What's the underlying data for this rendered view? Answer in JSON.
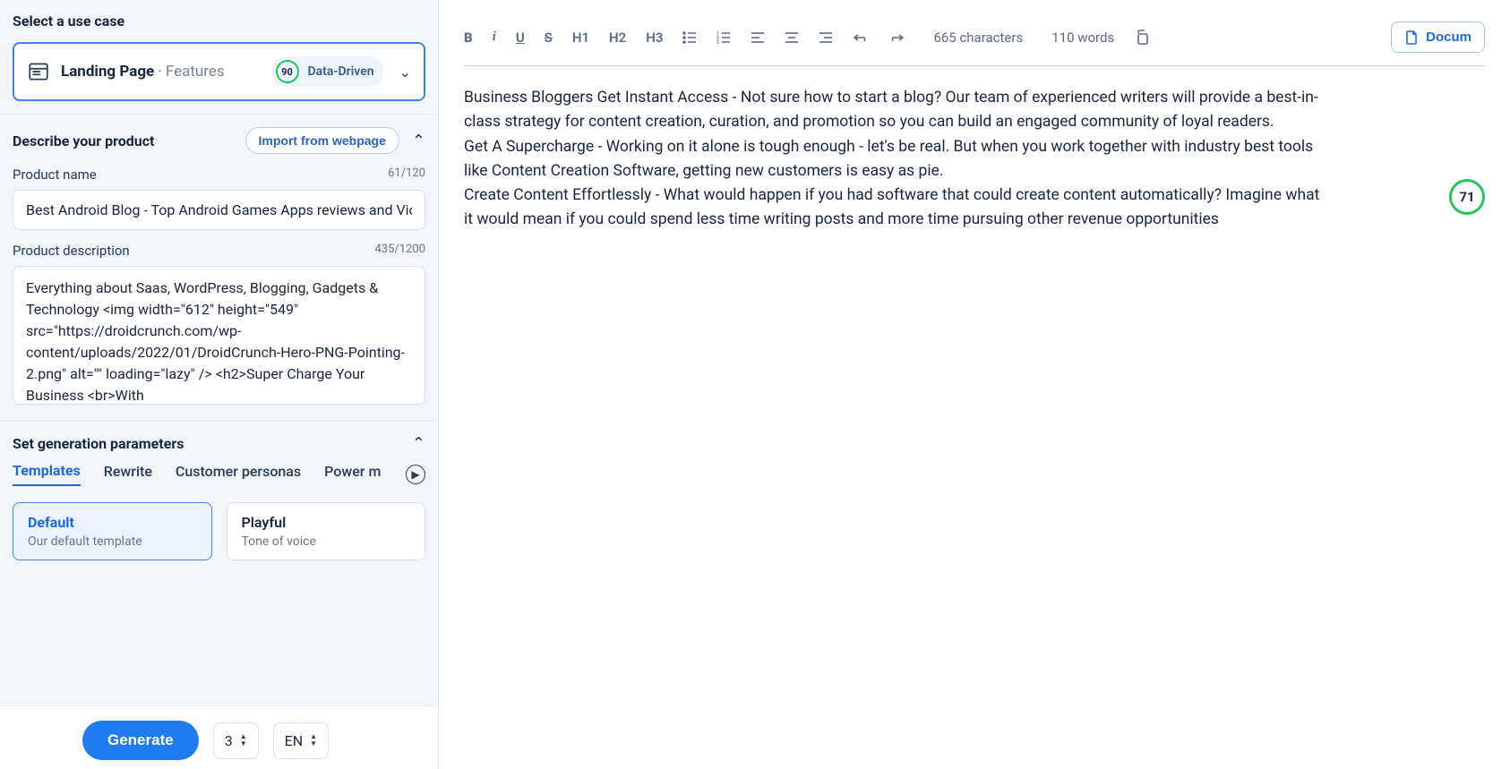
{
  "sidebar": {
    "select_use_case": "Select a use case",
    "use_case": {
      "label": "Landing Page",
      "sub": "Features",
      "score": "90",
      "tag": "Data-Driven"
    },
    "describe_heading": "Describe your product",
    "import_label": "Import from webpage",
    "product_name_label": "Product name",
    "product_name_counter": "61/120",
    "product_name_value": "Best Android Blog - Top Android Games Apps reviews and Videos",
    "product_desc_label": "Product description",
    "product_desc_counter": "435/1200",
    "product_desc_value": "Everything about Saas, WordPress, Blogging, Gadgets & Technology <img width=\"612\" height=\"549\" src=\"https://droidcrunch.com/wp-content/uploads/2022/01/DroidCrunch-Hero-PNG-Pointing-2.png\" alt=\"\" loading=\"lazy\" /> <h2>Super Charge Your Business <br>With",
    "set_gen_heading": "Set generation parameters",
    "tabs": [
      "Templates",
      "Rewrite",
      "Customer personas",
      "Power m"
    ],
    "templates": [
      {
        "title": "Default",
        "sub": "Our default template"
      },
      {
        "title": "Playful",
        "sub": "Tone of voice"
      }
    ],
    "generate": "Generate",
    "qty": "3",
    "lang": "EN"
  },
  "editor": {
    "toolbar": {
      "b": "B",
      "i": "i",
      "u": "U",
      "s": "S",
      "h1": "H1",
      "h2": "H2",
      "h3": "H3"
    },
    "chars": "665 characters",
    "words": "110 words",
    "doc_btn": "Docum",
    "content_text": "Business Bloggers Get Instant Access - Not sure how to start a blog? Our team of experienced writers will provide a best-in-class strategy for content creation, curation, and promotion so you can build an engaged community of loyal readers.\nGet A Supercharge - Working on it alone is tough enough - let's be real. But when you work together with industry best tools like Content Creation Software, getting new customers is easy as pie.\nCreate Content Effortlessly - What would happen if you had software that could create content automatically? Imagine what it would mean if you could spend less time writing posts and more time pursuing other revenue opportunities",
    "score": "71"
  }
}
